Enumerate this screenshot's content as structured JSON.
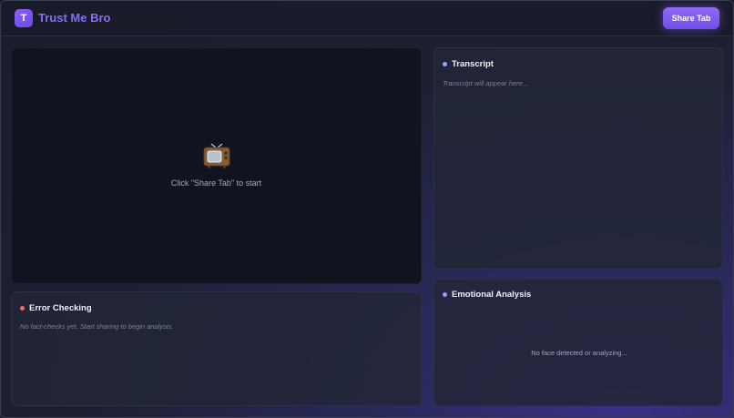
{
  "app": {
    "logo_letter": "T",
    "title": "Trust Me Bro",
    "share_button": "Share Tab"
  },
  "video": {
    "icon": "tv-icon",
    "hint": "Click \"Share Tab\" to start"
  },
  "transcript": {
    "heading": "Transcript",
    "placeholder": "Transcript will appear here...",
    "dot_color": "#8fa8f8"
  },
  "error_checking": {
    "heading": "Error Checking",
    "placeholder": "No fact-checks yet. Start sharing to begin analysis.",
    "dot_color": "#f26b6b"
  },
  "emotional_analysis": {
    "heading": "Emotional Analysis",
    "status": "No face detected or analyzing...",
    "dot_color": "#b48cf8"
  },
  "colors": {
    "accent": "#8b5cf6",
    "title": "#8b6cf5",
    "background": "#1a1d2b"
  }
}
